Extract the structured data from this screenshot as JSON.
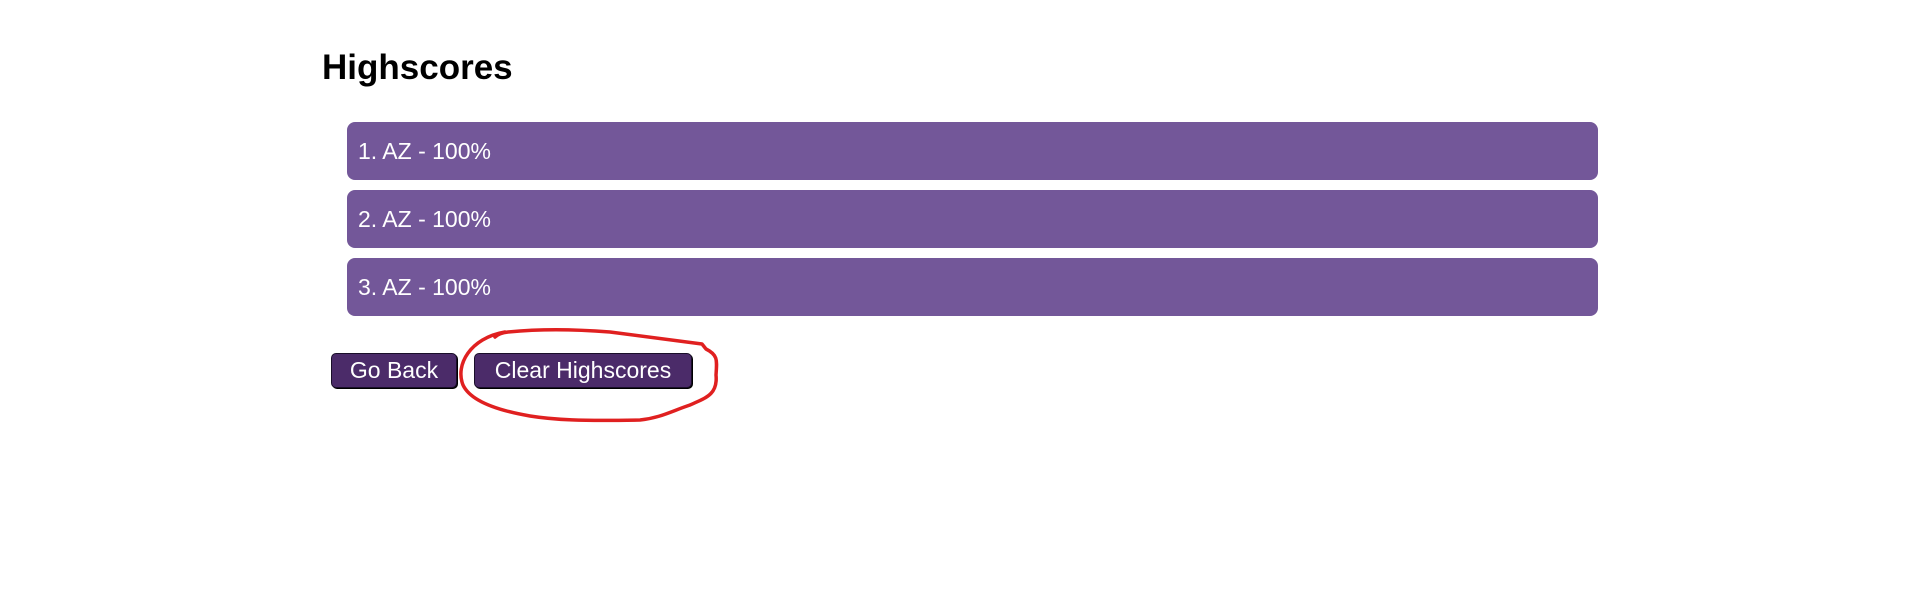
{
  "page": {
    "title": "Highscores"
  },
  "highscores": [
    {
      "label": "1. AZ - 100%"
    },
    {
      "label": "2. AZ - 100%"
    },
    {
      "label": "3. AZ - 100%"
    }
  ],
  "buttons": {
    "go_back_label": "Go Back",
    "clear_label": "Clear Highscores"
  },
  "colors": {
    "list_item_bg": "#735799",
    "button_bg": "#4b2b69",
    "annotation": "#e02020"
  }
}
